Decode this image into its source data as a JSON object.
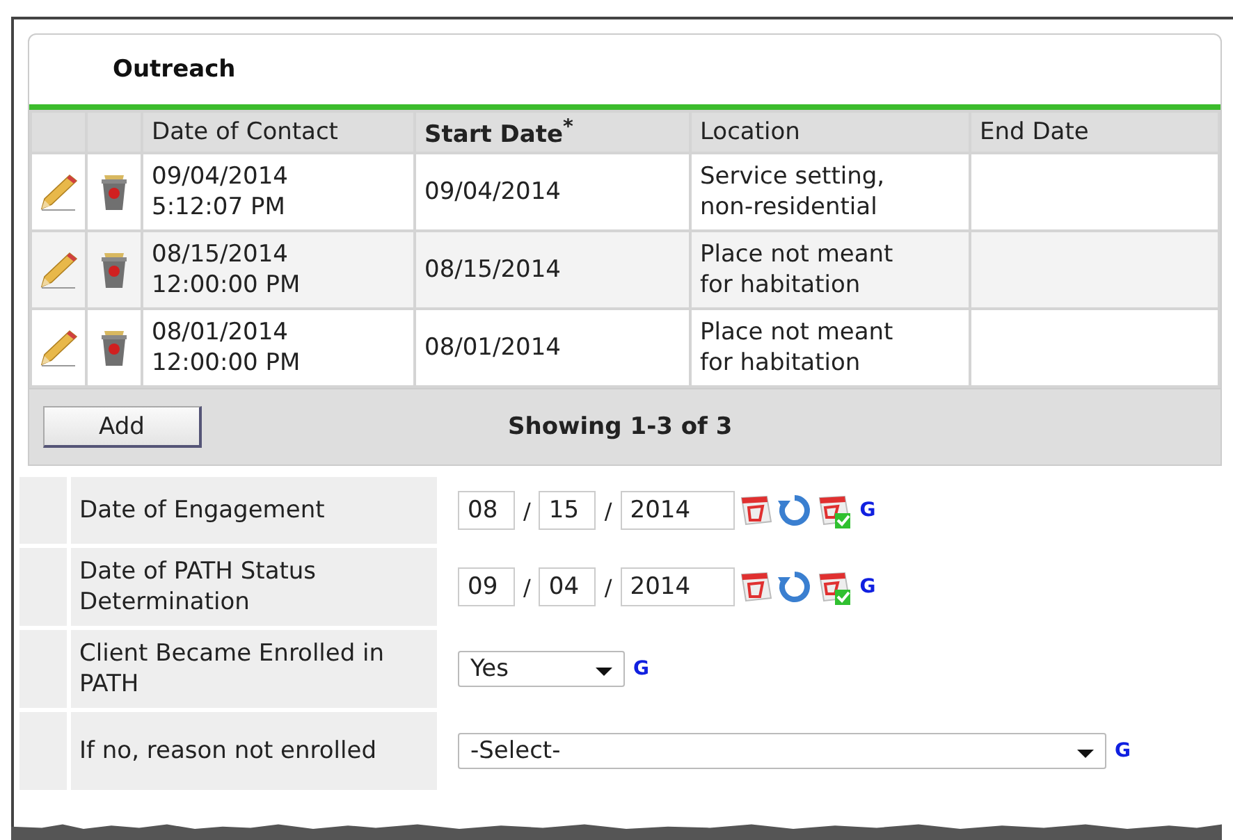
{
  "section": {
    "title": "Outreach"
  },
  "table": {
    "columns": [
      {
        "label": "Date of Contact",
        "sorted": false
      },
      {
        "label": "Start Date$^{*}$",
        "sorted": true
      },
      {
        "label": "Location",
        "sorted": false
      },
      {
        "label": "End Date",
        "sorted": false
      }
    ],
    "rows": [
      {
        "date_of_contact": [
          "09/04/2014",
          "5:12:07 PM"
        ],
        "start_date": "09/04/2014",
        "location": [
          "Service setting,",
          "non-residential"
        ]
      },
      {
        "date_of_contact": [
          "08/15/2014",
          "12:00:00 PM"
        ],
        "start_date": "08/15/2014",
        "location": [
          "Place not meant",
          "for habitation"
        ]
      },
      {
        "date_of_contact": [
          "08/01/2014",
          "12:00:00 PM"
        ],
        "start_date": "08/01/2014",
        "location": [
          "Place not meant",
          "for habitation"
        ]
      }
    ],
    "add_button": "Add",
    "summary": "Showing 1-3 of 3"
  },
  "form": [
    {
      "kind": "date",
      "label": "Date of Engagement",
      "month": "08",
      "day": "15",
      "year": "2014",
      "separator": "/",
      "link": "G"
    },
    {
      "kind": "date",
      "label": "Date of PATH Status Determination",
      "month": "09",
      "day": "04",
      "year": "2014",
      "separator": "/",
      "link": "G"
    },
    {
      "kind": "select",
      "label": "Client Became Enrolled in PATH",
      "value": "Yes",
      "link": "G"
    },
    {
      "kind": "wide-select",
      "label": "If no, reason not enrolled",
      "value": "-Select-",
      "link": "G"
    }
  ]
}
